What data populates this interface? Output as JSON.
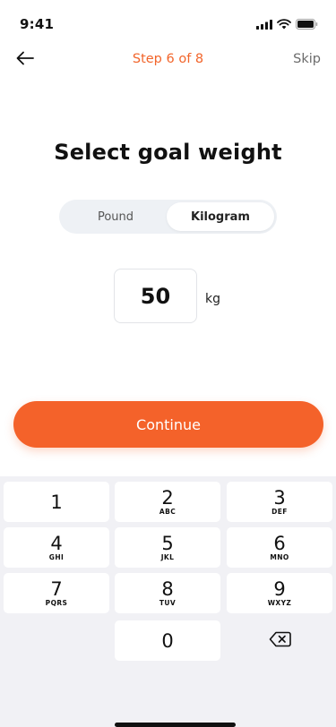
{
  "status_bar": {
    "time": "9:41"
  },
  "nav": {
    "step": "Step 6 of 8",
    "skip": "Skip"
  },
  "title": "Select goal weight",
  "unit_toggle": {
    "options": [
      "Pound",
      "Kilogram"
    ],
    "selected": "Kilogram"
  },
  "weight": {
    "value": "50",
    "unit": "kg"
  },
  "continue_label": "Continue",
  "keypad": {
    "keys": [
      {
        "num": "1",
        "letters": ""
      },
      {
        "num": "2",
        "letters": "ABC"
      },
      {
        "num": "3",
        "letters": "DEF"
      },
      {
        "num": "4",
        "letters": "GHI"
      },
      {
        "num": "5",
        "letters": "JKL"
      },
      {
        "num": "6",
        "letters": "MNO"
      },
      {
        "num": "7",
        "letters": "PQRS"
      },
      {
        "num": "8",
        "letters": "TUV"
      },
      {
        "num": "9",
        "letters": "WXYZ"
      },
      {
        "num": "0",
        "letters": ""
      }
    ]
  },
  "colors": {
    "accent": "#f4622a",
    "keyboard_bg": "#f1f1f5",
    "toggle_bg": "#eef1f5"
  }
}
